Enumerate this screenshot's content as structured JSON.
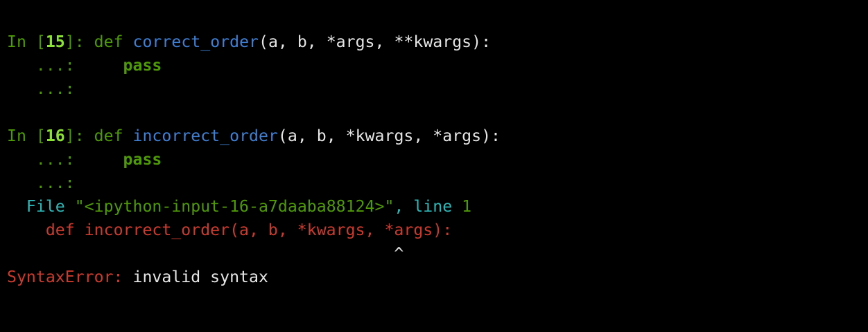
{
  "cells": [
    {
      "prompt_prefix": "In [",
      "number": "15",
      "prompt_suffix": "]: ",
      "def_kw": "def",
      "fn_name": "correct_order",
      "params": "(a, b, *args, **kwargs):",
      "cont1": "   ...: ",
      "body_indent": "    ",
      "body_kw": "pass",
      "cont2": "   ...:"
    },
    {
      "prompt_prefix": "In [",
      "number": "16",
      "prompt_suffix": "]: ",
      "def_kw": "def",
      "fn_name": "incorrect_order",
      "params": "(a, b, *kwargs, *args):",
      "cont1": "   ...: ",
      "body_indent": "    ",
      "body_kw": "pass",
      "cont2": "   ...:"
    }
  ],
  "traceback": {
    "file_indent": "  ",
    "file_label": "File ",
    "file_path": "\"<ipython-input-16-a7daaba88124>\"",
    "file_sep": ", ",
    "line_label": "line ",
    "line_num": "1",
    "code_indent": "    ",
    "code": "def incorrect_order(a, b, *kwargs, *args):",
    "caret_indent": "                                        ",
    "caret": "^",
    "error_name": "SyntaxError:",
    "error_msg": " invalid syntax"
  },
  "colors": {
    "background": "#000000",
    "prompt_green": "#4e9a06",
    "prompt_number": "#8ae234",
    "function_blue": "#3f7fd4",
    "traceback_cyan": "#2fb7b7",
    "error_red": "#cc3a2e",
    "text": "#e5e5e5"
  }
}
